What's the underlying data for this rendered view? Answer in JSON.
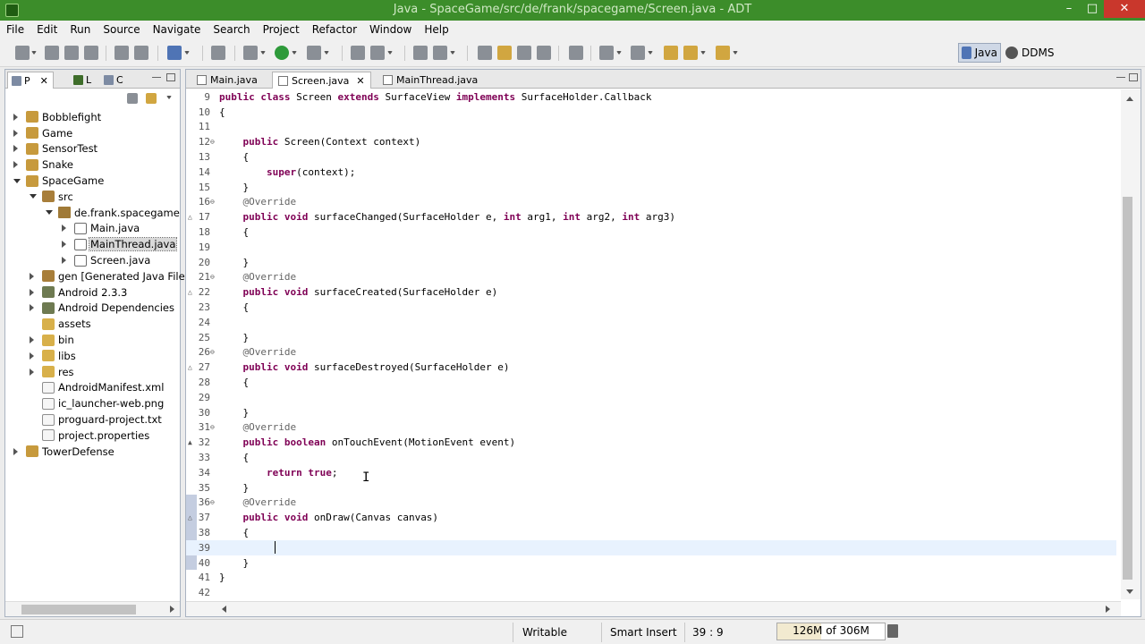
{
  "window": {
    "title": "Java - SpaceGame/src/de/frank/spacegame/Screen.java - ADT",
    "min": "–",
    "max": "□",
    "close": "✕"
  },
  "menu": [
    "File",
    "Edit",
    "Run",
    "Source",
    "Navigate",
    "Search",
    "Project",
    "Refactor",
    "Window",
    "Help"
  ],
  "perspectives": {
    "java": "Java",
    "ddms": "DDMS"
  },
  "left_tabs": [
    "P",
    "L",
    "C"
  ],
  "tree": [
    {
      "label": "Bobblefight",
      "indent": 0,
      "icon": "proj",
      "arrow": "r"
    },
    {
      "label": "Game",
      "indent": 0,
      "icon": "proj",
      "arrow": "r"
    },
    {
      "label": "SensorTest",
      "indent": 0,
      "icon": "proj",
      "arrow": "r"
    },
    {
      "label": "Snake",
      "indent": 0,
      "icon": "proj",
      "arrow": "r"
    },
    {
      "label": "SpaceGame",
      "indent": 0,
      "icon": "proj",
      "arrow": "d"
    },
    {
      "label": "src",
      "indent": 1,
      "icon": "pkgf",
      "arrow": "d"
    },
    {
      "label": "de.frank.spacegame",
      "indent": 2,
      "icon": "pkg",
      "arrow": "d"
    },
    {
      "label": "Main.java",
      "indent": 3,
      "icon": "jfile",
      "arrow": "r"
    },
    {
      "label": "MainThread.java",
      "indent": 3,
      "icon": "jfile",
      "arrow": "r",
      "selected": true
    },
    {
      "label": "Screen.java",
      "indent": 3,
      "icon": "jfile",
      "arrow": "r"
    },
    {
      "label": "gen [Generated Java Files]",
      "indent": 1,
      "icon": "pkgf",
      "arrow": "r"
    },
    {
      "label": "Android 2.3.3",
      "indent": 1,
      "icon": "lib",
      "arrow": "r"
    },
    {
      "label": "Android Dependencies",
      "indent": 1,
      "icon": "lib",
      "arrow": "r"
    },
    {
      "label": "assets",
      "indent": 1,
      "icon": "folder",
      "arrow": ""
    },
    {
      "label": "bin",
      "indent": 1,
      "icon": "folder",
      "arrow": "r"
    },
    {
      "label": "libs",
      "indent": 1,
      "icon": "folder",
      "arrow": "r"
    },
    {
      "label": "res",
      "indent": 1,
      "icon": "folder",
      "arrow": "r"
    },
    {
      "label": "AndroidManifest.xml",
      "indent": 1,
      "icon": "file",
      "arrow": ""
    },
    {
      "label": "ic_launcher-web.png",
      "indent": 1,
      "icon": "file",
      "arrow": ""
    },
    {
      "label": "proguard-project.txt",
      "indent": 1,
      "icon": "file",
      "arrow": ""
    },
    {
      "label": "project.properties",
      "indent": 1,
      "icon": "file",
      "arrow": ""
    },
    {
      "label": "TowerDefense",
      "indent": 0,
      "icon": "proj",
      "arrow": "r"
    }
  ],
  "editor_tabs": [
    {
      "label": "Main.java"
    },
    {
      "label": "Screen.java",
      "active": true,
      "close": "✕"
    },
    {
      "label": "MainThread.java"
    }
  ],
  "code": [
    {
      "n": "9",
      "html": "<span class=\"kw\">public class</span> Screen <span class=\"kw\">extends</span> SurfaceView <span class=\"kw\">implements</span> SurfaceHolder.Callback"
    },
    {
      "n": "10",
      "html": "{"
    },
    {
      "n": "11",
      "html": ""
    },
    {
      "n": "12",
      "fold": "⊖",
      "html": "    <span class=\"kw\">public</span> Screen(Context context)"
    },
    {
      "n": "13",
      "html": "    {"
    },
    {
      "n": "14",
      "html": "        <span class=\"kw\">super</span>(context);"
    },
    {
      "n": "15",
      "html": "    }"
    },
    {
      "n": "16",
      "fold": "⊖",
      "html": "    <span class=\"ann\">@Override</span>"
    },
    {
      "n": "17",
      "mark": "△",
      "html": "    <span class=\"kw\">public void</span> surfaceChanged(SurfaceHolder e, <span class=\"kw\">int</span> arg1, <span class=\"kw\">int</span> arg2, <span class=\"kw\">int</span> arg3)"
    },
    {
      "n": "18",
      "html": "    {"
    },
    {
      "n": "19",
      "html": ""
    },
    {
      "n": "20",
      "html": "    }"
    },
    {
      "n": "21",
      "fold": "⊖",
      "html": "    <span class=\"ann\">@Override</span>"
    },
    {
      "n": "22",
      "mark": "△",
      "html": "    <span class=\"kw\">public void</span> surfaceCreated(SurfaceHolder e)"
    },
    {
      "n": "23",
      "html": "    {"
    },
    {
      "n": "24",
      "html": ""
    },
    {
      "n": "25",
      "html": "    }"
    },
    {
      "n": "26",
      "fold": "⊖",
      "html": "    <span class=\"ann\">@Override</span>"
    },
    {
      "n": "27",
      "mark": "△",
      "html": "    <span class=\"kw\">public void</span> surfaceDestroyed(SurfaceHolder e)"
    },
    {
      "n": "28",
      "html": "    {"
    },
    {
      "n": "29",
      "html": ""
    },
    {
      "n": "30",
      "html": "    }"
    },
    {
      "n": "31",
      "fold": "⊖",
      "html": "    <span class=\"ann\">@Override</span>"
    },
    {
      "n": "32",
      "mark": "▲",
      "html": "    <span class=\"kw\">public boolean</span> onTouchEvent(MotionEvent event)"
    },
    {
      "n": "33",
      "html": "    {"
    },
    {
      "n": "34",
      "html": "        <span class=\"kw\">return true</span>;"
    },
    {
      "n": "35",
      "html": "    }"
    },
    {
      "n": "36",
      "fold": "⊖",
      "html": "    <span class=\"ann\">@Override</span>"
    },
    {
      "n": "37",
      "mark": "△",
      "html": "    <span class=\"kw\">public void</span> onDraw(Canvas canvas)"
    },
    {
      "n": "38",
      "html": "    {"
    },
    {
      "n": "39",
      "current": true,
      "html": "        "
    },
    {
      "n": "40",
      "html": "    }"
    },
    {
      "n": "41",
      "html": "}"
    },
    {
      "n": "42",
      "html": ""
    }
  ],
  "status": {
    "writable": "Writable",
    "insert_mode": "Smart Insert",
    "position": "39 : 9",
    "heap": "126M of 306M",
    "heap_fraction": 0.41
  },
  "colors": {
    "titlebar": "#3c8d2a",
    "keyword": "#7f0055",
    "annotation": "#646464",
    "current_line": "#e8f2fe"
  }
}
